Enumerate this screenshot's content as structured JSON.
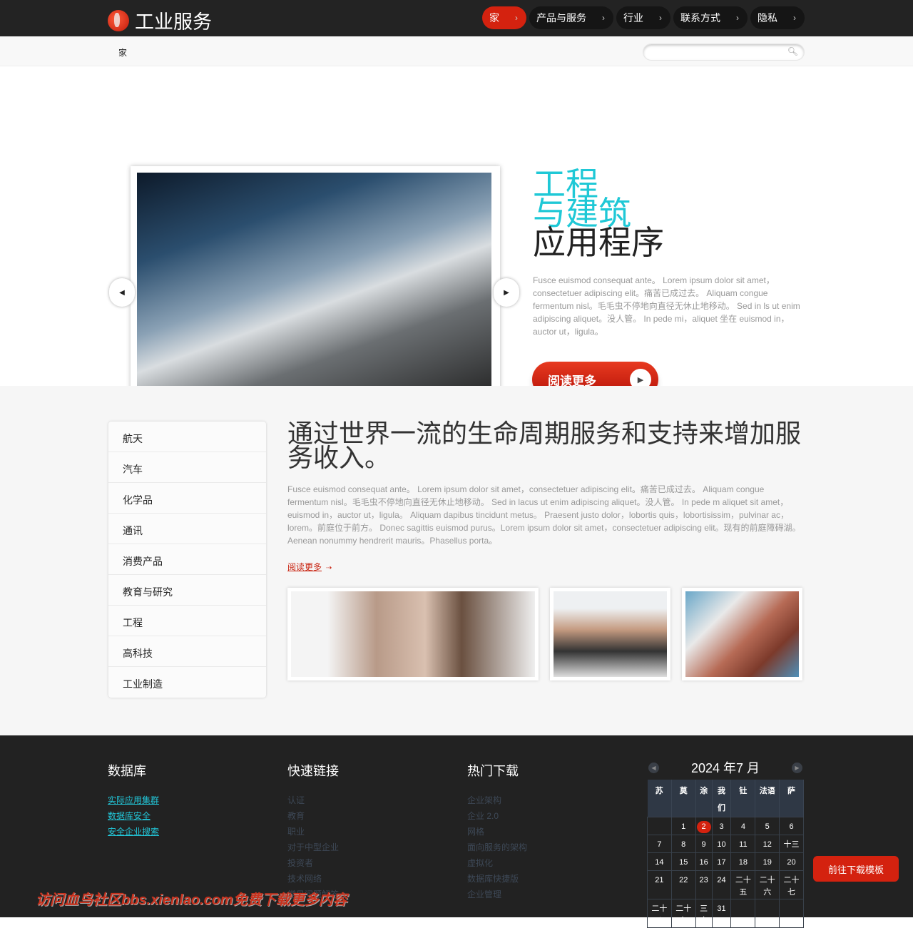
{
  "header": {
    "site_title": "工业服务",
    "nav": [
      {
        "label": "家",
        "active": true
      },
      {
        "label": "产品与服务"
      },
      {
        "label": "行业"
      },
      {
        "label": "联系方式"
      },
      {
        "label": "隐私"
      }
    ]
  },
  "breadcrumb": "家",
  "search": {
    "placeholder": "",
    "value": ""
  },
  "hero": {
    "title_line1": "工程",
    "title_line2": "与建筑",
    "title_line3": "应用程序",
    "text": "Fusce euismod consequat ante。 Lorem ipsum dolor sit amet，consectetuer adipiscing elit。痛苦已成过去。 Aliquam congue fermentum nisl。毛毛虫不停地向直径无休止地移动。 Sed in ls ut enim adipiscing aliquet。没人管。 In pede mi，aliquet 坐在 euismod in，auctor ut，ligula。",
    "button": "阅读更多"
  },
  "sidebar": [
    "航天",
    "汽车",
    "化学品",
    "通讯",
    "消费产品",
    "教育与研究",
    "工程",
    "高科技",
    "工业制造"
  ],
  "main": {
    "heading": "通过世界一流的生命周期服务和支持来增加服务收入。",
    "text": "Fusce euismod consequat ante。 Lorem ipsum dolor sit amet，consectetuer adipiscing elit。痛苦已成过去。 Aliquam congue fermentum nisl。毛毛虫不停地向直径无休止地移动。 Sed in lacus ut enim adipiscing aliquet。没人管。 In pede m aliquet sit amet，euismod in，auctor ut，ligula。 Aliquam dapibus tincidunt metus。 Praesent justo dolor，lobortis quis，lobortisissim，pulvinar ac，lorem。前庭位于前方。 Donec sagittis euismod purus。Lorem ipsum dolor sit amet，consectetuer adipiscing elit。现有的前庭障碍湖。 Aenean nonummy hendrerit mauris。Phasellus porta。",
    "more": "阅读更多"
  },
  "footer": {
    "db": {
      "title": "数据库",
      "links": [
        "实际应用集群",
        "数据库安全",
        "安全企业搜索"
      ]
    },
    "quick": {
      "title": "快速链接",
      "links": [
        "认证",
        "教育",
        "职业",
        "对于中型企业",
        "投资者",
        "技术网络",
        "常见问题解答"
      ]
    },
    "downloads": {
      "title": "热门下载",
      "links": [
        "企业架构",
        "企业 2.0",
        "网格",
        "面向服务的架构",
        "虚拟化",
        "数据库快捷版",
        "企业管理"
      ]
    },
    "calendar": {
      "title": "2024 年7 月",
      "weekdays": [
        "苏",
        "莫",
        "涂",
        "我们",
        "钍",
        "法语",
        "萨"
      ],
      "today": "2",
      "weeks": [
        [
          "",
          "1",
          "2",
          "3",
          "4",
          "5",
          "6"
        ],
        [
          "7",
          "8",
          "9",
          "10",
          "11",
          "12",
          "十三"
        ],
        [
          "14",
          "15",
          "16",
          "17",
          "18",
          "19",
          "20"
        ],
        [
          "21",
          "22",
          "23",
          "24",
          "二十五",
          "二十六",
          "二十七"
        ],
        [
          "二十八",
          "二十九",
          "三十",
          "31",
          "",
          "",
          ""
        ]
      ]
    }
  },
  "download_button": "前往下载模板",
  "watermark": "访问血鸟社区bbs.xienlao.com免费下载更多内容",
  "colors": {
    "accent_red": "#d4220f",
    "accent_cyan": "#1fc8d6",
    "footer_bg": "#222222"
  }
}
